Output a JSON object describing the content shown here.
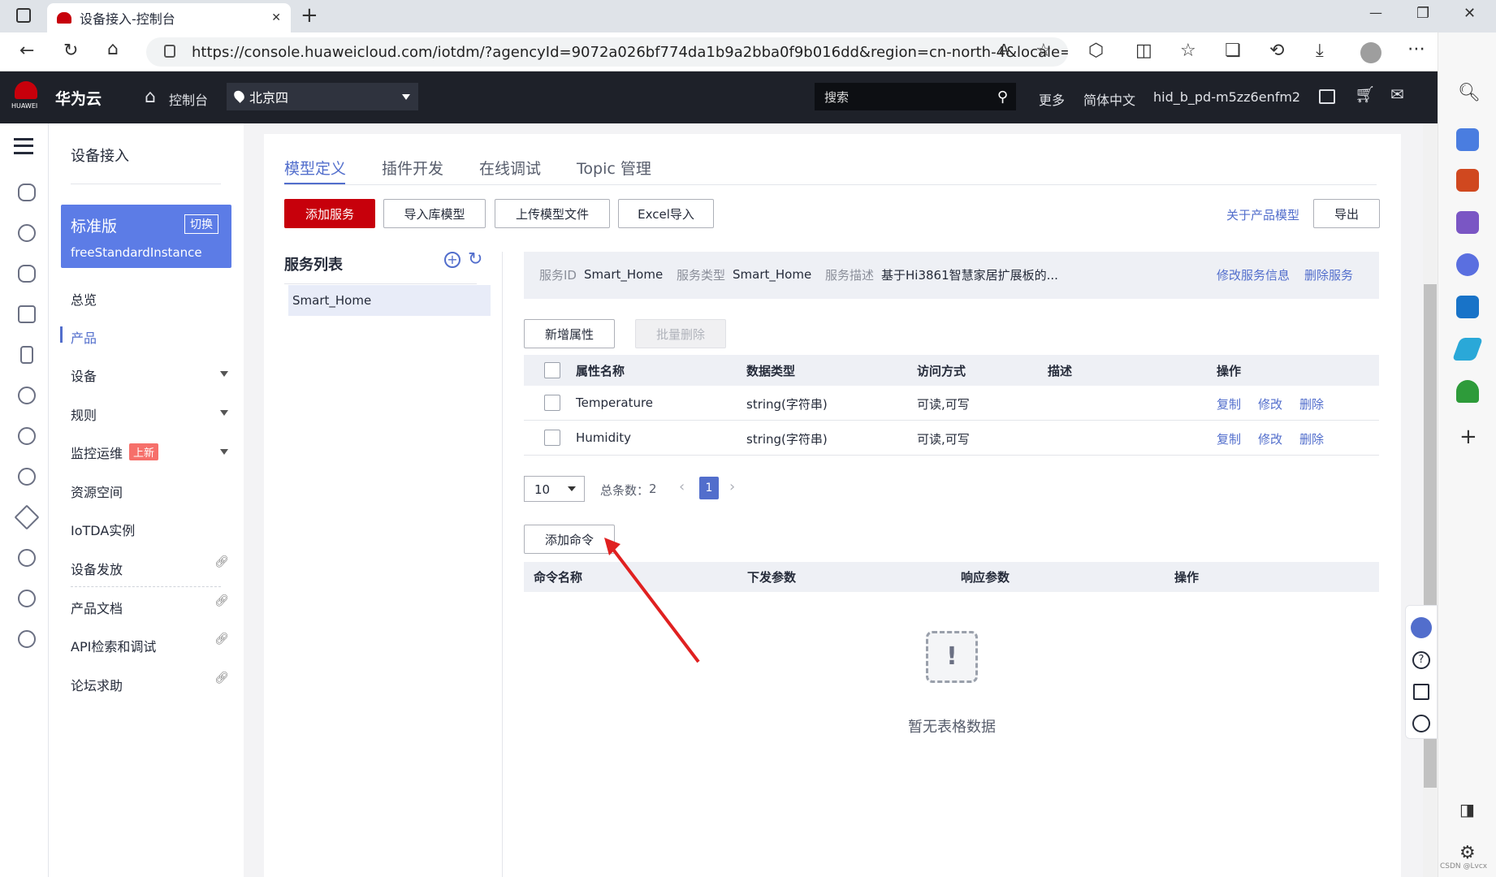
{
  "browser": {
    "tab_title": "设备接入-控制台",
    "tab_close": "✕",
    "new_tab": "+",
    "url": "https://console.huaweicloud.com/iotdm/?agencyId=9072a026bf774da1b9a2bba0f9b016dd&region=cn-north-4&locale=zh-...",
    "window_min": "—",
    "window_max": "❐",
    "window_close": "✕",
    "watermark": "CSDN @Lvcx"
  },
  "header": {
    "logo_text": "华为云",
    "logo_sub": "HUAWEI",
    "console": "控制台",
    "region": "北京四",
    "search_placeholder": "搜索",
    "more": "更多",
    "language": "简体中文",
    "user": "hid_b_pd-m5zz6enfm2"
  },
  "sidebar": {
    "title": "设备接入",
    "edition": "标准版",
    "switch": "切换",
    "instance": "freeStandardInstance",
    "items": [
      {
        "label": "总览"
      },
      {
        "label": "产品"
      },
      {
        "label": "设备"
      },
      {
        "label": "规则"
      },
      {
        "label": "监控运维"
      },
      {
        "label": "资源空间"
      },
      {
        "label": "IoTDA实例"
      },
      {
        "label": "设备发放"
      },
      {
        "label": "产品文档"
      },
      {
        "label": "API检索和调试"
      },
      {
        "label": "论坛求助"
      }
    ],
    "new_badge": "上新"
  },
  "tabs": [
    {
      "label": "模型定义"
    },
    {
      "label": "插件开发"
    },
    {
      "label": "在线调试"
    },
    {
      "label": "Topic 管理"
    }
  ],
  "toolbar": {
    "add_service": "添加服务",
    "import_model": "导入库模型",
    "upload_model": "上传模型文件",
    "excel_import": "Excel导入",
    "about_model": "关于产品模型",
    "export": "导出"
  },
  "service_list": {
    "title": "服务列表",
    "items": [
      "Smart_Home"
    ]
  },
  "service_info": {
    "id_label": "服务ID",
    "id": "Smart_Home",
    "type_label": "服务类型",
    "type": "Smart_Home",
    "desc_label": "服务描述",
    "desc": "基于Hi3861智慧家居扩展板的...",
    "edit": "修改服务信息",
    "delete": "删除服务"
  },
  "properties": {
    "add": "新增属性",
    "batch_delete": "批量删除",
    "columns": [
      "属性名称",
      "数据类型",
      "访问方式",
      "描述",
      "操作"
    ],
    "rows": [
      {
        "name": "Temperature",
        "type": "string(字符串)",
        "access": "可读,可写",
        "desc": ""
      },
      {
        "name": "Humidity",
        "type": "string(字符串)",
        "access": "可读,可写",
        "desc": ""
      }
    ],
    "actions": [
      "复制",
      "修改",
      "删除"
    ],
    "page_size": "10",
    "total_label": "总条数：",
    "total": "2",
    "page": "1"
  },
  "commands": {
    "add": "添加命令",
    "columns": [
      "命令名称",
      "下发参数",
      "响应参数",
      "操作"
    ],
    "empty": "暂无表格数据"
  },
  "colors": {
    "accent": "#526ecc",
    "primary_red": "#c7000b",
    "header_bg": "#1e2129",
    "arrow": "#e02020"
  }
}
